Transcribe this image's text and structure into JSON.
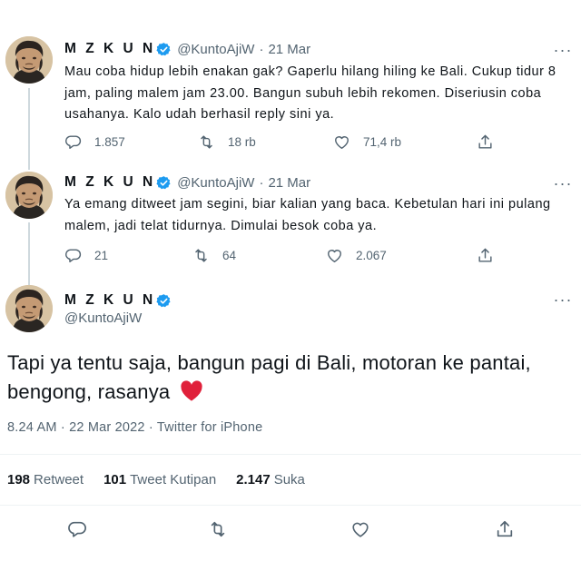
{
  "tweets": [
    {
      "name": "M Z K U N",
      "handle": "@KuntoAjiW",
      "separator": "·",
      "date": "21 Mar",
      "text": "Mau coba hidup lebih enakan gak? Gaperlu hilang hiling ke Bali. Cukup tidur 8 jam, paling malem jam 23.00. Bangun subuh lebih rekomen. Diseriusin coba usahanya. Kalo udah berhasil reply sini ya.",
      "replies": "1.857",
      "retweets": "18 rb",
      "likes": "71,4 rb"
    },
    {
      "name": "M Z K U N",
      "handle": "@KuntoAjiW",
      "separator": "·",
      "date": "21 Mar",
      "text": "Ya emang ditweet jam segini, biar kalian yang baca. Kebetulan hari ini pulang malem, jadi telat tidurnya. Dimulai besok coba ya.",
      "replies": "21",
      "retweets": "64",
      "likes": "2.067"
    }
  ],
  "main_tweet": {
    "name": "M Z K U N",
    "handle": "@KuntoAjiW",
    "text": "Tapi ya tentu saja, bangun pagi di Bali, motoran ke pantai, bengong, rasanya",
    "meta": "8.24 AM · 22 Mar 2022 · Twitter for iPhone",
    "stats": {
      "retweets_count": "198",
      "retweets_label": "Retweet",
      "quotes_count": "101",
      "quotes_label": "Tweet Kutipan",
      "likes_count": "2.147",
      "likes_label": "Suka"
    }
  },
  "icons": {
    "reply": "reply-icon",
    "retweet": "retweet-icon",
    "like": "heart-icon",
    "share": "share-icon",
    "more": "more-icon",
    "verified": "verified-badge-icon",
    "emoji": "red-heart-emoji"
  },
  "colors": {
    "verified": "#1d9bf0",
    "secondary_text": "#536471",
    "heart_emoji": "#e0203a"
  }
}
